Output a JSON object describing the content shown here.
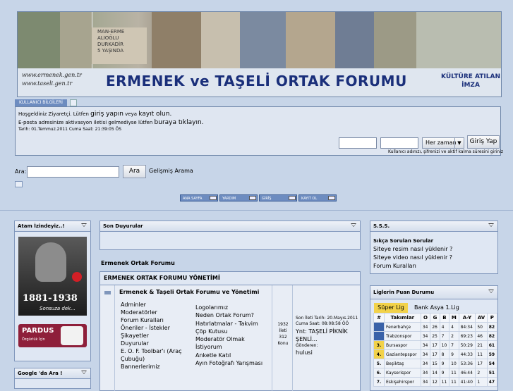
{
  "banner": {
    "title": "ERMENEK ve TAŞELİ ORTAK FORUMU",
    "urls": [
      "www.ermenek.gen.tr",
      "www.taseli.gen.tr"
    ],
    "slogan": [
      "KÜLTÜRE ATILAN",
      "İMZA"
    ],
    "stone_text": [
      "MAN-ERME",
      "ALIOĞLU",
      "DURKADİR",
      "5 YAŞINDA"
    ]
  },
  "login": {
    "tab_label": "KULLANICI BİLGİLERİ",
    "welcome_prefix": "Hoşgeldiniz Ziyaretçi.",
    "welcome_mid": "Lütfen",
    "login_link": "giriş yapın",
    "or": "veya",
    "register_link": "kayıt olun.",
    "email_prefix": "E-posta adresinize aktivasyon iletisi gelmediyse lütfen",
    "email_link": "buraya tıklayın.",
    "date": "Tarih: 01.Temmuz.2011 Cuma Saat: 21:39:05 ÖS",
    "username_value": "",
    "password_value": "",
    "duration_value": "Her zaman",
    "login_button": "Giriş Yap",
    "hint": "Kullanıcı adınızı, şifrenizi ve aktif kalma süresini giriniz"
  },
  "search": {
    "label": "Ara:",
    "value": "",
    "button": "Ara",
    "advanced": "Gelişmiş Arama"
  },
  "nav": [
    {
      "label": "ANA SAYFA"
    },
    {
      "label": "YARDIM"
    },
    {
      "label": "GİRİŞ"
    },
    {
      "label": "KAYIT OL"
    }
  ],
  "left": {
    "ataturk_title": "Atam İzindeyiz..!",
    "ataturk_years": "1881-1938",
    "ataturk_caption": "Sonsuza dek...",
    "pardus_label": "PARDUS",
    "pardus_sub": "Özgürlük İçin",
    "google_title": "Google 'da Ara !"
  },
  "middle": {
    "announcements_title": "Son Duyurular",
    "forum_heading": "Ermenek Ortak Forumu",
    "section_title": "ERMENEK ORTAK FORUMU YÖNETİMİ",
    "forum_title": "Ermenek & Taşeli Ortak Forumu ve Yönetimi",
    "col1": [
      "Adminler",
      "Moderatörler",
      "Forum Kuralları",
      "Öneriler - İstekler",
      "Şikayetler",
      "Duyurular",
      "E. O. F. Toolbar'ı (Araç Çubuğu)",
      "Bannerlerimiz"
    ],
    "col2": [
      "Logolarımız",
      "Neden Ortak Forum?",
      "Hatırlatmalar - Takvim",
      "Çöp Kutusu",
      "Moderatör Olmak",
      "İstiyorum",
      "Anketle Katıl",
      "Ayın Fotoğrafı Yarışması"
    ],
    "stats": [
      "1932",
      "İleti",
      "312",
      "Konu"
    ],
    "last_post_date": "Son İleti Tarih: 20.Mayıs.2011 Cuma Saat: 08:08:58 ÖÖ",
    "last_post_title": "Ynt: TAŞELİ PİKNİK ŞENLİ...",
    "sent_by": "Gönderen:",
    "last_post_user": "hulusi"
  },
  "right": {
    "faq_title": "S.S.S.",
    "faq_items": [
      "Sıkça Sorulan Sorular",
      "Siteye resim nasıl yüklenir ?",
      "Siteye video nasıl yüklenir ?",
      "Forum Kuralları"
    ],
    "league_title": "Liglerin Puan Durumu",
    "tabs": [
      "Süper Lig",
      "Bank Asya 1.Lig"
    ],
    "headers": [
      "#",
      "Takımlar",
      "O",
      "G",
      "B",
      "M",
      "A-Y",
      "AV",
      "P"
    ],
    "rows": [
      [
        "1.",
        "Fenerbahçe",
        "34",
        "26",
        "4",
        "4",
        "84:34",
        "50",
        "82"
      ],
      [
        "2.",
        "Trabzonspor",
        "34",
        "25",
        "7",
        "2",
        "69:23",
        "46",
        "82"
      ],
      [
        "3.",
        "Bursaspor",
        "34",
        "17",
        "10",
        "7",
        "50:29",
        "21",
        "61"
      ],
      [
        "4.",
        "Gaziantepspor",
        "34",
        "17",
        "8",
        "9",
        "44:33",
        "11",
        "59"
      ],
      [
        "5.",
        "Beşiktaş",
        "34",
        "15",
        "9",
        "10",
        "53:36",
        "17",
        "54"
      ],
      [
        "6.",
        "Kayserispor",
        "34",
        "14",
        "9",
        "11",
        "46:44",
        "2",
        "51"
      ],
      [
        "7.",
        "Eskişehirspor",
        "34",
        "12",
        "11",
        "11",
        "41:40",
        "1",
        "47"
      ]
    ]
  },
  "colors": {
    "accent": "#1a2f7a",
    "panel": "#dfe7f3",
    "nav": "#6d8cc0",
    "rank_yellow": "#f2d24a",
    "rank_blue": "#3a62a8"
  }
}
